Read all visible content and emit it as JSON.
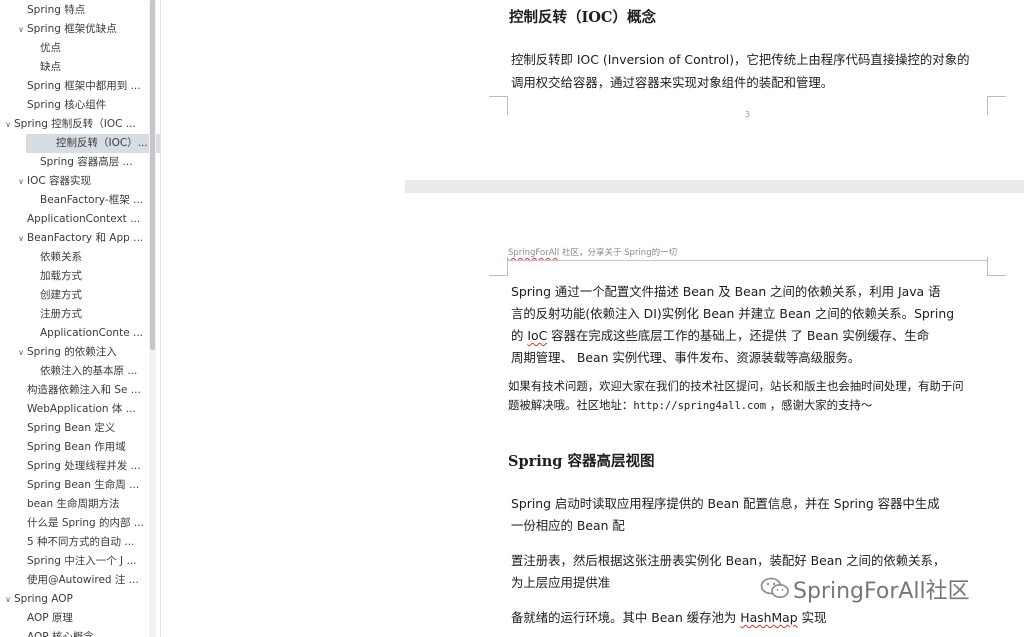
{
  "nav": {
    "items": [
      {
        "label": "Spring 特点",
        "chevron": ""
      },
      {
        "label": "Spring 框架优缺点",
        "chevron": "∨"
      },
      {
        "label": "优点",
        "chevron": ""
      },
      {
        "label": "缺点",
        "chevron": ""
      },
      {
        "label": "Spring 框架中都用到 ...",
        "chevron": ""
      },
      {
        "label": "Spring 核心组件",
        "chevron": ""
      },
      {
        "label": "Spring 控制反转（IOC ...",
        "chevron": "∨"
      },
      {
        "label": "控制反转（IOC）...",
        "chevron": "",
        "selected": true
      },
      {
        "label": "Spring 容器高层 ...",
        "chevron": ""
      },
      {
        "label": "IOC 容器实现",
        "chevron": "∨"
      },
      {
        "label": "BeanFactory-框架 ...",
        "chevron": ""
      },
      {
        "label": "ApplicationContext ...",
        "chevron": ""
      },
      {
        "label": "BeanFactory 和 App ...",
        "chevron": "∨"
      },
      {
        "label": "依赖关系",
        "chevron": ""
      },
      {
        "label": "加载方式",
        "chevron": ""
      },
      {
        "label": "创建方式",
        "chevron": ""
      },
      {
        "label": "注册方式",
        "chevron": ""
      },
      {
        "label": "ApplicationConte ...",
        "chevron": ""
      },
      {
        "label": "Spring 的依赖注入",
        "chevron": "∨"
      },
      {
        "label": "依赖注入的基本原 ...",
        "chevron": ""
      },
      {
        "label": "构造器依赖注入和 Se ...",
        "chevron": ""
      },
      {
        "label": "WebApplication 体 ...",
        "chevron": ""
      },
      {
        "label": "Spring Bean 定义",
        "chevron": ""
      },
      {
        "label": "Spring Bean 作用域",
        "chevron": ""
      },
      {
        "label": "Spring 处理线程并发 ...",
        "chevron": ""
      },
      {
        "label": "Spring Bean 生命周 ...",
        "chevron": ""
      },
      {
        "label": "bean 生命周期方法",
        "chevron": ""
      },
      {
        "label": "什么是 Spring 的内部 ...",
        "chevron": ""
      },
      {
        "label": "5 种不同方式的自动 ...",
        "chevron": ""
      },
      {
        "label": "Spring 中注入一个 J ...",
        "chevron": ""
      },
      {
        "label": "使用@Autowired 注 ...",
        "chevron": ""
      },
      {
        "label": "Spring AOP",
        "chevron": "∨"
      },
      {
        "label": "AOP 原理",
        "chevron": ""
      },
      {
        "label": "AOP 核心概念",
        "chevron": ""
      }
    ]
  },
  "page3": {
    "heading": "控制反转（IOC）概念",
    "para_line1": "控制反转即 IOC (Inversion of Control)，它把传统上由程序代码直接操控的对象的",
    "para_line2": "调用权交给容器，通过容器来实现对象组件的装配和管理。",
    "page_number": "3"
  },
  "page4": {
    "header_brand": "SpringForAll",
    "header_rest": " 社区，分享关于 Spring的一切",
    "p1_l1": "Spring 通过一个配置文件描述 Bean 及 Bean 之间的依赖关系，利用 Java 语",
    "p1_l2": "言的反射功能(依赖注入 DI)实例化 Bean 并建立 Bean 之间的依赖关系。Spring",
    "p1_l3_a": "的 ",
    "p1_l3_ioc": "IoC",
    "p1_l3_b": " 容器在完成这些底层工作的基础上，还提供 了 Bean 实例缓存、生命",
    "p1_l4": "周期管理、 Bean 实例代理、事件发布、资源装载等高级服务。",
    "note_l1": "如果有技术问题，欢迎大家在我们的技术社区提问，站长和版主也会抽时间处理，有助于问",
    "note_l2_a": "题被解决哦。社区地址：",
    "note_link": "http://spring4all.com",
    "note_l2_b": "  ，感谢大家的支持～",
    "heading2": "Spring 容器高层视图",
    "p2_l1": "Spring 启动时读取应用程序提供的 Bean 配置信息，并在 Spring 容器中生成",
    "p2_l2": "一份相应的 Bean 配",
    "p3_l1": "置注册表，然后根据这张注册表实例化 Bean，装配好 Bean 之间的依赖关系，",
    "p3_l2": "为上层应用提供准",
    "p4_a": "备就绪的运行环境。其中 Bean 缓存池为 ",
    "p4_hashmap": "HashMap",
    "p4_b": " 实现"
  },
  "watermark": {
    "text": "SpringForAll社区",
    "icon": "wechat-icon"
  },
  "colors": {
    "sidebar_selected": "#d8dde3",
    "page_bg": "#ffffff",
    "gap": "#ebebeb"
  }
}
